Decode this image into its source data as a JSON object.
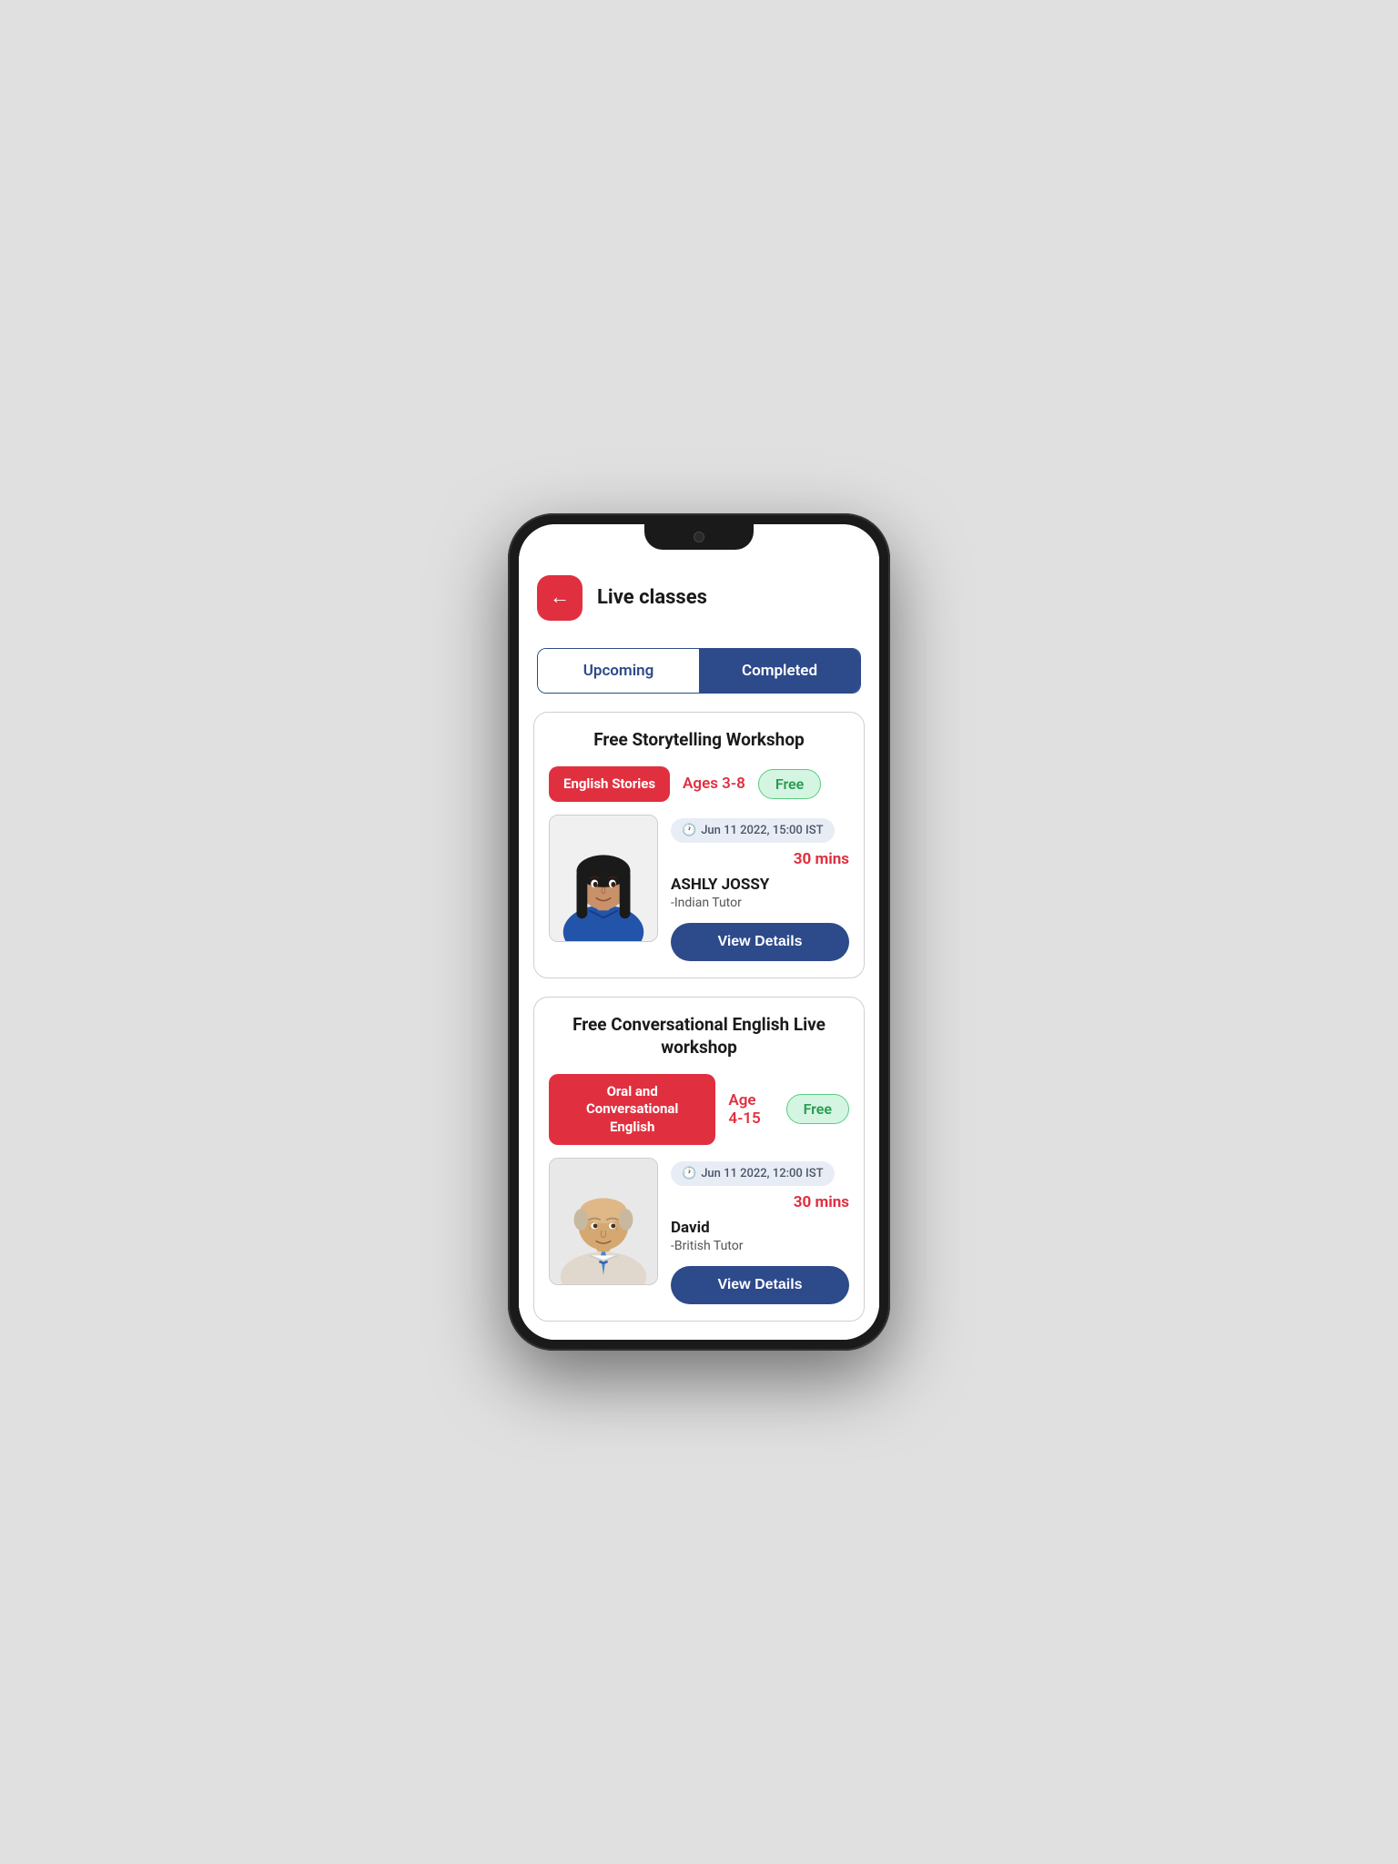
{
  "header": {
    "back_label": "←",
    "title": "Live classes"
  },
  "tabs": [
    {
      "id": "upcoming",
      "label": "Upcoming",
      "active": false
    },
    {
      "id": "completed",
      "label": "Completed",
      "active": true
    }
  ],
  "cards": [
    {
      "id": "card1",
      "title": "Free Storytelling Workshop",
      "category": "English Stories",
      "age": "Ages 3-8",
      "free_label": "Free",
      "schedule": "Jun 11 2022, 15:00 IST",
      "duration": "30 mins",
      "tutor_name": "ASHLY JOSSY",
      "tutor_type": "-Indian Tutor",
      "view_details_label": "View Details",
      "tutor_gender": "female"
    },
    {
      "id": "card2",
      "title": "Free Conversational English Live workshop",
      "category": "Oral and Conversational English",
      "age": "Age 4-15",
      "free_label": "Free",
      "schedule": "Jun 11 2022, 12:00 IST",
      "duration": "30 mins",
      "tutor_name": "David",
      "tutor_type": "-British Tutor",
      "view_details_label": "View Details",
      "tutor_gender": "male"
    }
  ],
  "icons": {
    "clock": "🕐"
  }
}
